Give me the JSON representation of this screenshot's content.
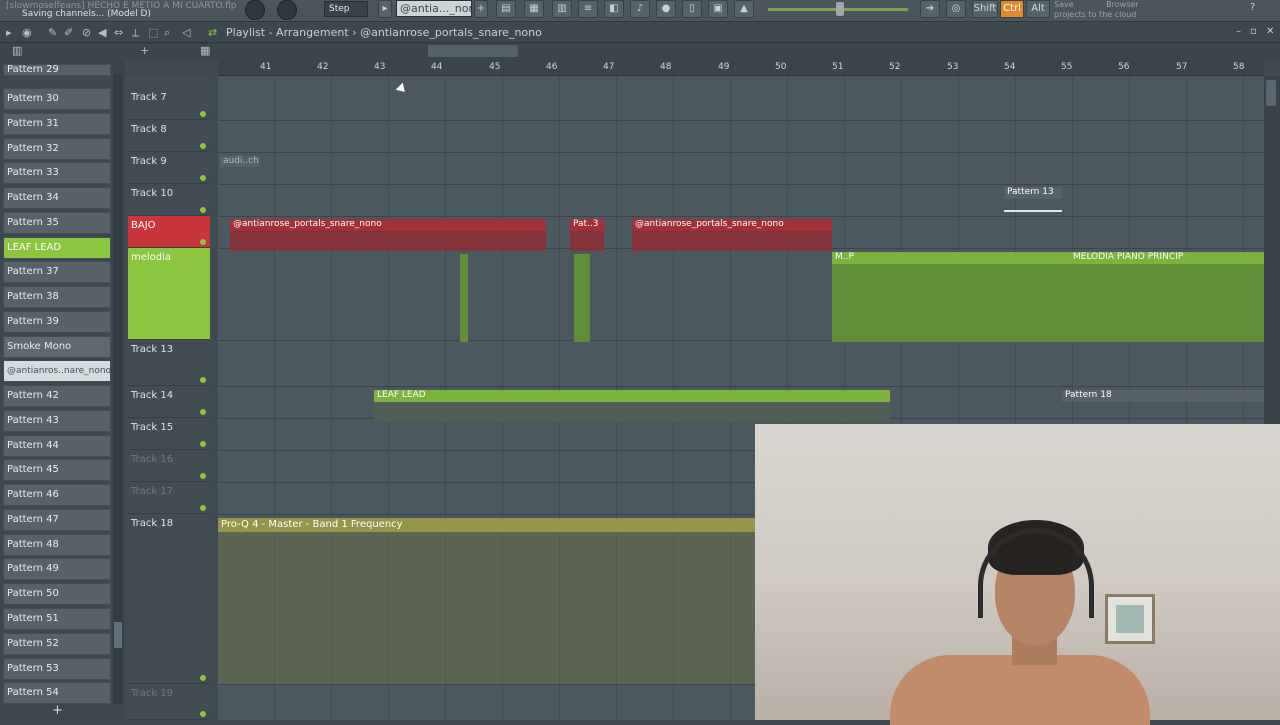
{
  "topbar": {
    "hint_top": "[slowmoselfeans] HECHO E METIO A MI CUARTO.flp",
    "hint_status": "Saving channels... (Model D)",
    "step_label": "Step",
    "pattern_selector": "@antia..._nono",
    "shift_label": "Shift",
    "ctrl_label": "Ctrl",
    "alt_label": "Alt",
    "browser_tip_1": "Save",
    "browser_tip_2": "projects to the cloud",
    "browser_label": "Browser"
  },
  "playlist": {
    "title": "Playlist - Arrangement",
    "separator": "›",
    "pattern": "@antianrose_portals_snare_nono"
  },
  "ruler": [
    "41",
    "42",
    "43",
    "44",
    "45",
    "46",
    "47",
    "48",
    "49",
    "50",
    "51",
    "52",
    "53",
    "54",
    "55",
    "56",
    "57",
    "58"
  ],
  "patterns": [
    {
      "label": "Pattern 29"
    },
    {
      "label": "Pattern 30"
    },
    {
      "label": "Pattern 31"
    },
    {
      "label": "Pattern 32"
    },
    {
      "label": "Pattern 33"
    },
    {
      "label": "Pattern 34"
    },
    {
      "label": "Pattern 35"
    },
    {
      "label": "LEAF LEAD"
    },
    {
      "label": "Pattern 37"
    },
    {
      "label": "Pattern 38"
    },
    {
      "label": "Pattern 39"
    },
    {
      "label": "Smoke Mono"
    },
    {
      "label": "@antianros..nare_nono"
    },
    {
      "label": "Pattern 42"
    },
    {
      "label": "Pattern 43"
    },
    {
      "label": "Pattern 44"
    },
    {
      "label": "Pattern 45"
    },
    {
      "label": "Pattern 46"
    },
    {
      "label": "Pattern 47"
    },
    {
      "label": "Pattern 48"
    },
    {
      "label": "Pattern 49"
    },
    {
      "label": "Pattern 50"
    },
    {
      "label": "Pattern 51"
    },
    {
      "label": "Pattern 52"
    },
    {
      "label": "Pattern 53"
    },
    {
      "label": "Pattern 54"
    }
  ],
  "tracks": [
    {
      "label": "Track 7"
    },
    {
      "label": "Track 8"
    },
    {
      "label": "Track 9"
    },
    {
      "label": "Track 10"
    },
    {
      "label": "BAJO"
    },
    {
      "label": "melodia"
    },
    {
      "label": "Track 13"
    },
    {
      "label": "Track 14"
    },
    {
      "label": "Track 15"
    },
    {
      "label": "Track 16"
    },
    {
      "label": "Track 17"
    },
    {
      "label": "Track 18"
    },
    {
      "label": "Track 19"
    }
  ],
  "clips": {
    "audio": "audi..ch",
    "pattern13": "Pattern 13",
    "bajo_1": "@antianrose_portals_snare_nono",
    "bajo_2": "Pat..3",
    "bajo_3": "@antianrose_portals_snare_nono",
    "melodia_short": "M..P",
    "melodia_long": "MELODIA PIANO PRINCIP",
    "leaf_lead": "LEAF LEAD",
    "pattern18": "Pattern 18",
    "automation": "Pro-Q 4 - Master - Band 1 Frequency"
  }
}
